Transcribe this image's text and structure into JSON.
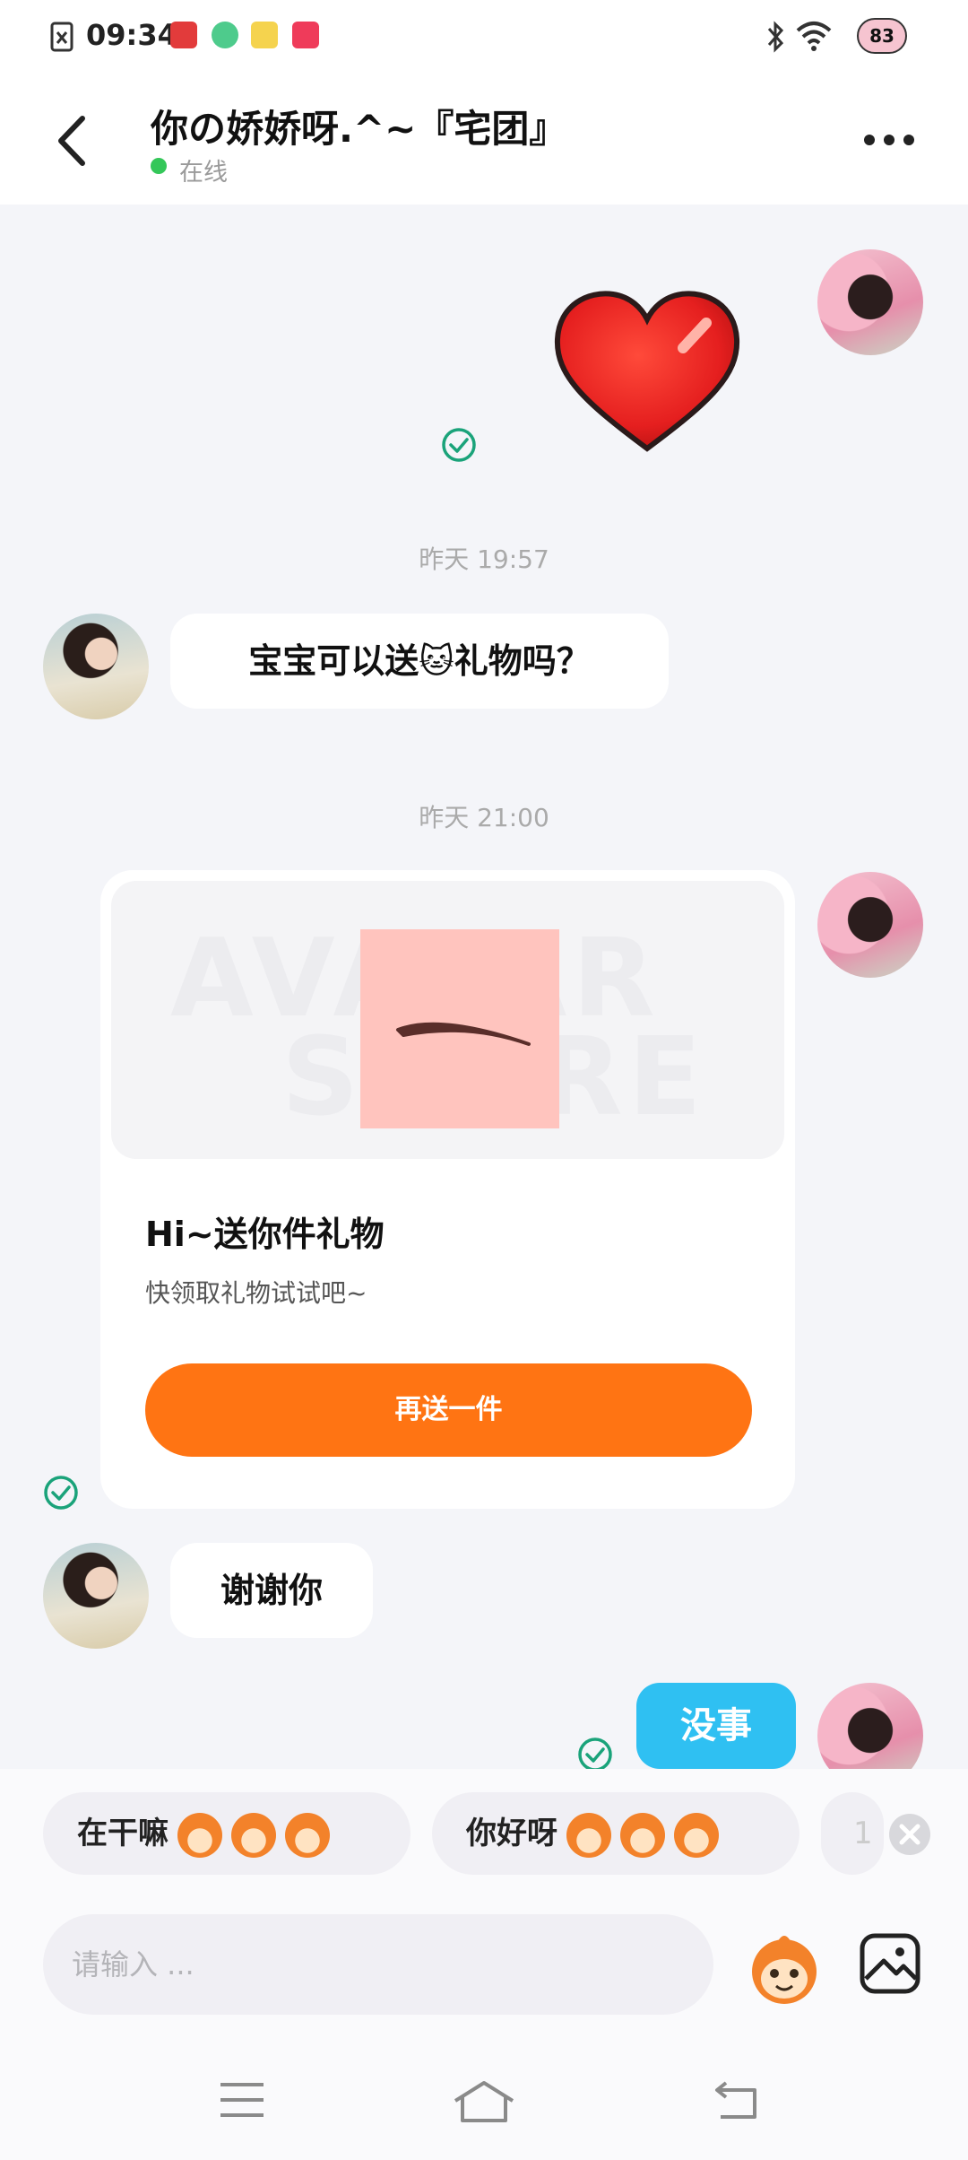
{
  "status_bar": {
    "time": "09:34",
    "battery": "83"
  },
  "header": {
    "title": "你の娇娇呀.^~『宅团』",
    "status": "在线",
    "back_icon": "chevron-left-icon",
    "more_icon": "more-dots-icon"
  },
  "chat": {
    "timestamp_1": "昨天 19:57",
    "msg_1": "宝宝可以送🐱礼物吗？",
    "timestamp_2": "昨天 21:00",
    "gift": {
      "watermark_1": "AVATAR",
      "watermark_2": "STORE",
      "title": "Hi~送你件礼物",
      "subtitle": "快领取礼物试试吧~",
      "button": "再送一件"
    },
    "msg_2": "谢谢你",
    "my_reply": "没事"
  },
  "quick_replies": [
    {
      "label": "在干嘛"
    },
    {
      "label": "你好呀"
    },
    {
      "label": "1"
    }
  ],
  "input": {
    "placeholder": "请输入 ..."
  },
  "colors": {
    "accent_orange": "#ff7413",
    "my_bubble": "#2fc0f2",
    "online": "#34c759",
    "read_check": "#1aa37a"
  }
}
